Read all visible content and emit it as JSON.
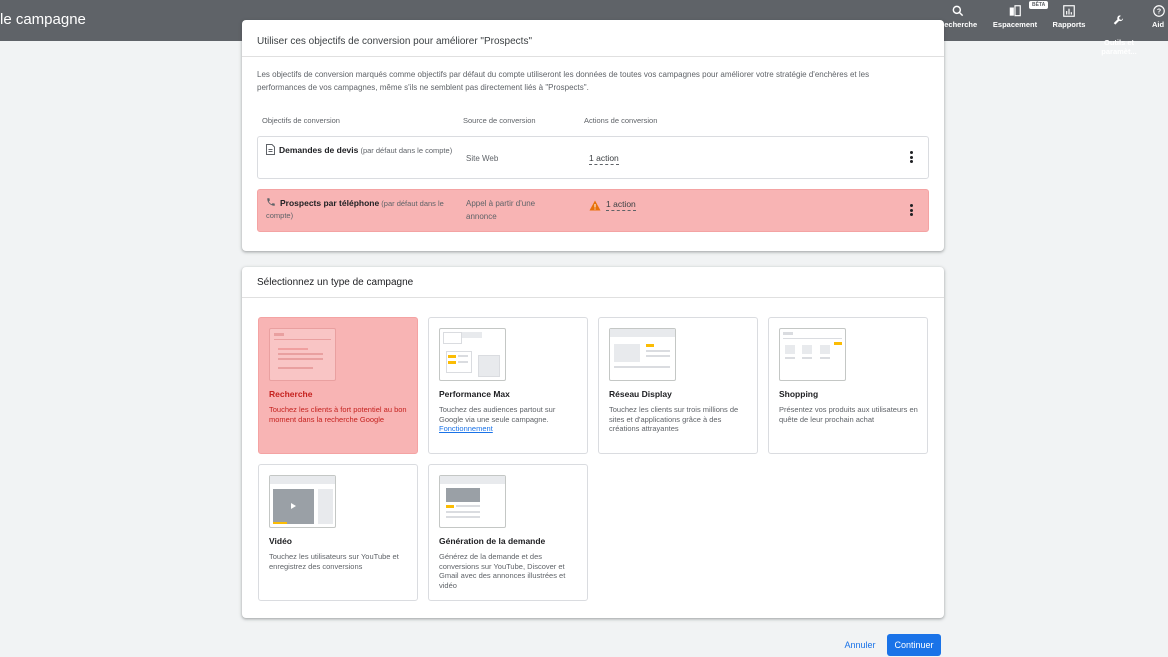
{
  "header": {
    "title": "le campagne",
    "nav": [
      {
        "label": "Recherche",
        "icon": "search-icon"
      },
      {
        "label": "Espacement",
        "icon": "workspace-icon",
        "badge": "BÊTA"
      },
      {
        "label": "Rapports",
        "icon": "reports-icon"
      },
      {
        "label": "Outils et\nparamèt...",
        "icon": "wrench-icon"
      },
      {
        "label": "Aid",
        "icon": "help-icon"
      }
    ]
  },
  "goals": {
    "heading": "Utiliser ces objectifs de conversion pour améliorer \"Prospects\"",
    "description": "Les objectifs de conversion marqués comme objectifs par défaut du compte utiliseront les données de toutes vos campagnes pour améliorer votre stratégie d'enchères et les performances de vos campagnes, même s'ils ne semblent pas directement liés à \"Prospects\".",
    "columns": [
      "Objectifs de conversion",
      "Source de conversion",
      "Actions de conversion"
    ],
    "rows": [
      {
        "name": "Demandes de devis",
        "note": "(par défaut dans le compte)",
        "source": "Site Web",
        "actions": "1 action",
        "warning": false,
        "icon": "document-icon"
      },
      {
        "name": "Prospects par téléphone",
        "note": "(par défaut dans le compte)",
        "source": "Appel à partir d'une annonce",
        "actions": "1 action",
        "warning": true,
        "icon": "phone-icon"
      }
    ]
  },
  "campaign": {
    "heading": "Sélectionnez un type de campagne",
    "types": [
      {
        "name": "Recherche",
        "desc": "Touchez les clients à fort potentiel au bon moment dans la recherche Google",
        "selected": true
      },
      {
        "name": "Performance Max",
        "desc": "Touchez des audiences partout sur Google via une seule campagne.",
        "link": "Fonctionnement",
        "selected": false
      },
      {
        "name": "Réseau Display",
        "desc": "Touchez les clients sur trois millions de sites et d'applications grâce à des créations attrayantes",
        "selected": false
      },
      {
        "name": "Shopping",
        "desc": "Présentez vos produits aux utilisateurs en quête de leur prochain achat",
        "selected": false
      },
      {
        "name": "Vidéo",
        "desc": "Touchez les utilisateurs sur YouTube et enregistrez des conversions",
        "selected": false
      },
      {
        "name": "Génération de la demande",
        "desc": "Générez de la demande et des conversions sur YouTube, Discover et Gmail avec des annonces illustrées et vidéo",
        "selected": false
      }
    ]
  },
  "footer": {
    "cancel_label": "Annuler",
    "continue_label": "Continuer"
  },
  "colors": {
    "topbar": "#5f6368",
    "highlight": "#f8b4b4",
    "primary": "#1a73e8",
    "warning": "#e8710a",
    "accent_yellow": "#fbbc04"
  }
}
